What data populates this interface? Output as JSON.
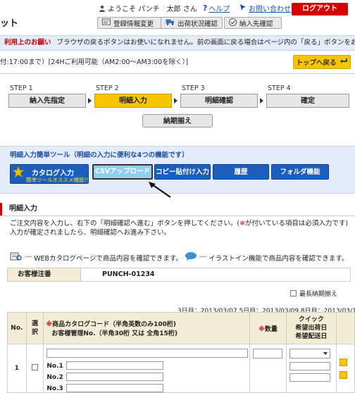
{
  "header": {
    "brand": "ット",
    "welcome": "ようこそ パンチ　太郎 さん",
    "help": "ヘルプ",
    "contact": "お問い合わせ",
    "logout": "ログアウト",
    "buttons": [
      "登録情報変更",
      "出荷状況確認",
      "納入先確認"
    ]
  },
  "notice": {
    "label": "利用上のお願い",
    "text": "ブラウザの戻るボタンはお使いになれません。前の画面に戻る場合はページ内の「戻る」ボタンをお使い下さい。"
  },
  "hours": "付:17:00まで）[24Hご利用可能（AM2:00〜AM3:00を除く）]",
  "back_to_top": "トップへ戻る",
  "steps": [
    {
      "label": "STEP 1",
      "name": "納入先指定"
    },
    {
      "label": "STEP 2",
      "name": "明細入力"
    },
    {
      "label": "STEP 3",
      "name": "明細確認"
    },
    {
      "label": "STEP 4",
      "name": "確定"
    }
  ],
  "sub_step": "納期揃え",
  "tools": {
    "title": "明細入力簡単ツール（明細の入力に便利な4つの機能です）",
    "catalog_label": "カタログ入力",
    "catalog_sub": "簡単ツールオススメ機能!!",
    "csv": "CSVアップロード",
    "paste": "コピー貼付け入力",
    "history": "履歴",
    "folder": "フォルダ機能"
  },
  "section_title": "明細入力",
  "instructions": {
    "line1_a": "ご注文内容を入力し、右下の「明細確認へ進む」ボタンを押してください。(",
    "line1_req": "※",
    "line1_b": "が付いている項目は必須入力です)",
    "line2": "入力が確定されましたら、明細確認へお進み下さい。"
  },
  "info": {
    "web_catalog": "WEBカタログページで商品内容を確認できます。",
    "illustration": "イラストイン機能で商品内容を確認できます。"
  },
  "customer": {
    "label": "お客様注番",
    "value": "PUNCH-01234"
  },
  "latest_delivery": "最長納期揃え",
  "delivery_dates": "3日目：2013/03/07  5日目：2013/03/09  8日目：2013/03/13",
  "table": {
    "headers": {
      "no": "No.",
      "select": "選択",
      "code_req": "※",
      "code_line1": "商品カタログコード（半角英数のみ100桁)",
      "code_line2": "お客様管理No.（半角30桁 又は 全角15桁)",
      "qty_req": "※",
      "qty": "数量",
      "quick1": "クイック",
      "quick2": "希望出荷日",
      "quick3": "希望配送日"
    },
    "rows": [
      {
        "no": "1",
        "sub_labels": [
          "No.1",
          "No.2",
          "No.3"
        ]
      }
    ]
  },
  "colors": {
    "accent_red": "#d40000",
    "step_active": "#f7c400",
    "tool_blue": "#1a5fc0"
  }
}
